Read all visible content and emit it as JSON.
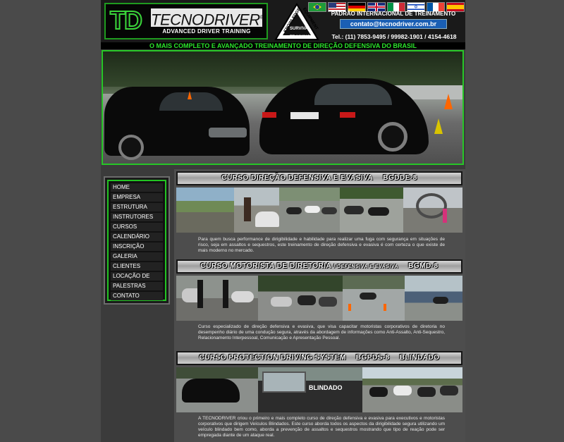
{
  "header": {
    "logo_td": "TD",
    "logo_name": "TECNODRIVER",
    "logo_reg": "®",
    "logo_sub": "ADVANCED DRIVER TRAINING",
    "survival_top": "KNOWLEDGE",
    "survival_right": "EQUIPMENT",
    "survival_center": "SURVIVAL",
    "survival_bottom": "TRAINING",
    "tagline": "PADRÃO INTERNACIONAL DE TREINAMENTO",
    "email": "contato@tecnodriver.com.br",
    "phone": "Tel.: (11) 7853-9495 / 99982-1901 / 4154-4618"
  },
  "flags": [
    "brazil-flag",
    "usa-flag",
    "germany-flag",
    "uk-flag",
    "italy-flag",
    "israel-flag",
    "france-flag",
    "spain-flag"
  ],
  "slogan": "O MAIS COMPLETO E AVANÇADO TREINAMENTO DE DIREÇÃO DEFENSIVA DO BRASIL",
  "menu": [
    "HOME",
    "EMPRESA",
    "ESTRUTURA",
    "INSTRUTORES",
    "CURSOS",
    "CALENDÁRIO",
    "INSCRIÇÃO",
    "GALERIA",
    "CLIENTES",
    "LOCAÇÃO DE PISTA",
    "PALESTRAS",
    "CONTATO"
  ],
  "sections": [
    {
      "title": "CURSO DIREÇÃO DEFENSIVA E EVASIVA",
      "code": "BGDDE-8",
      "desc": "Para quem busca performance de dirigibilidade e habilidade para realizar uma fuga com segurança em situações de risco, seja em assaltos e sequestros, este treinamento de direção defensiva e evasiva é com certeza o que existe de mais moderno no mercado."
    },
    {
      "title": "CURSO MOTORISTA DE DIRETORIA",
      "subtitle": "/ DEFENSIVA E EVASIVA",
      "code": "BGMD-8",
      "desc": "Curso especializado de direção defensiva e evasiva, que visa capacitar motoristas corporativos de diretoria no desempenho diário de uma condução segura, através da abordagem de informações como Anti-Assalto, Anti-Sequestro, Relacionamento Interpessoal, Comunicação e Apresentação Pessoal."
    },
    {
      "title": "CURSO PROTECTION DRIVING SYSTEM",
      "code": "BGPDS-8",
      "extra": "BLINDADO",
      "desc": "A TECNODRIVER criou o primeiro e mais completo curso de direção defensiva e evasiva para executivos e motoristas corporativos que dirigem Veículos Blindados. Este curso aborda todos os aspectos da dirigibilidade segura utilizando um veículo blindado bem como, aborda a prevenção de assaltos e sequestros mostrando que tipo de reação pode ser empregada diante de um ataque real."
    }
  ],
  "photo_label_blindado": "BLINDADO",
  "colors": {
    "accent_green": "#27c627",
    "email_blue": "#1a5fb4"
  }
}
